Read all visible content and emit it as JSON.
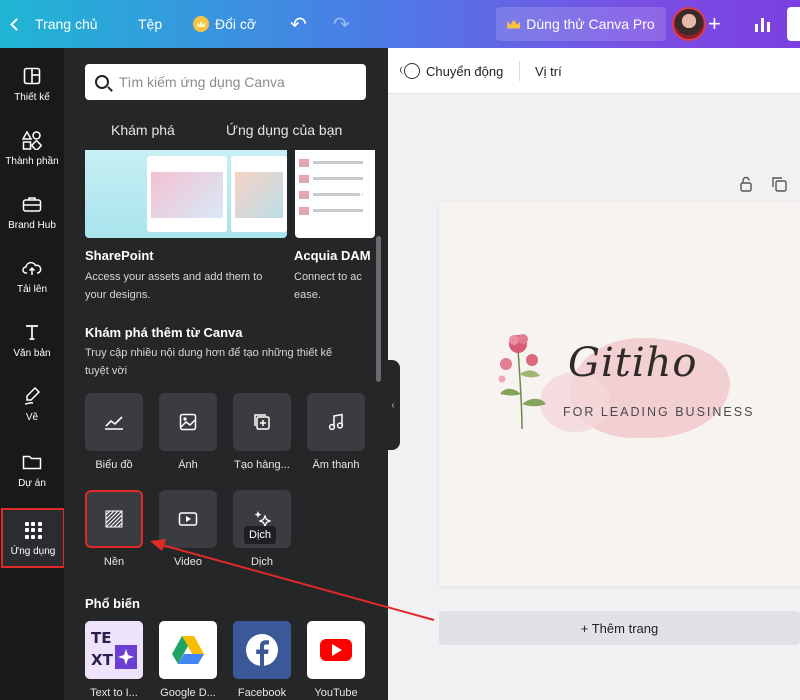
{
  "topbar": {
    "home_label": "Trang chủ",
    "file_label": "Tệp",
    "resize_label": "Đổi cỡ",
    "pro_label": "Dùng thử Canva Pro"
  },
  "rail": {
    "items": [
      {
        "label": "Thiết kế",
        "icon": "layout-icon"
      },
      {
        "label": "Thành phần",
        "icon": "shapes-icon"
      },
      {
        "label": "Brand Hub",
        "icon": "briefcase-icon"
      },
      {
        "label": "Tải lên",
        "icon": "cloud-upload-icon"
      },
      {
        "label": "Văn bản",
        "icon": "text-icon"
      },
      {
        "label": "Vẽ",
        "icon": "pen-icon"
      },
      {
        "label": "Dự án",
        "icon": "folder-icon"
      },
      {
        "label": "Ứng dụng",
        "icon": "apps-grid-icon"
      }
    ]
  },
  "panel": {
    "search_placeholder": "Tìm kiếm ứng dụng Canva",
    "tabs": [
      "Khám phá",
      "Ứng dụng của bạn"
    ],
    "featured": [
      {
        "title": "SharePoint",
        "desc": "Access your assets and add them to your designs."
      },
      {
        "title": "Acquia DAM",
        "desc": "Connect to ac ease."
      }
    ],
    "explore": {
      "title": "Khám phá thêm từ Canva",
      "desc": "Truy cập nhiều nội dung hơn để tạo những thiết kế tuyệt vời"
    },
    "apps": [
      {
        "label": "Biểu đồ",
        "icon": "chart-icon"
      },
      {
        "label": "Ảnh",
        "icon": "image-icon"
      },
      {
        "label": "Tạo hàng...",
        "icon": "batch-create-icon"
      },
      {
        "label": "Âm thanh",
        "icon": "music-icon"
      },
      {
        "label": "Nền",
        "icon": "background-pattern-icon"
      },
      {
        "label": "Video",
        "icon": "video-icon"
      },
      {
        "label": "Dịch",
        "icon": "translate-icon"
      }
    ],
    "tooltip": "Dịch",
    "popular": {
      "title": "Phổ biến",
      "items": [
        {
          "label": "Text to I...",
          "icon": "text-to-image-icon"
        },
        {
          "label": "Google D...",
          "icon": "google-drive-icon"
        },
        {
          "label": "Facebook",
          "icon": "facebook-icon"
        },
        {
          "label": "YouTube",
          "icon": "youtube-icon"
        }
      ]
    }
  },
  "toolbar": {
    "animate_label": "Chuyển động",
    "position_label": "Vị trí"
  },
  "canvas": {
    "logo_script": "Gitiho",
    "logo_tagline": "FOR LEADING BUSINESS",
    "add_page_label": "+ Thêm trang"
  },
  "colors": {
    "accent": "#7e6ef5",
    "highlight": "#e02a2a",
    "panel_bg": "#252627"
  }
}
